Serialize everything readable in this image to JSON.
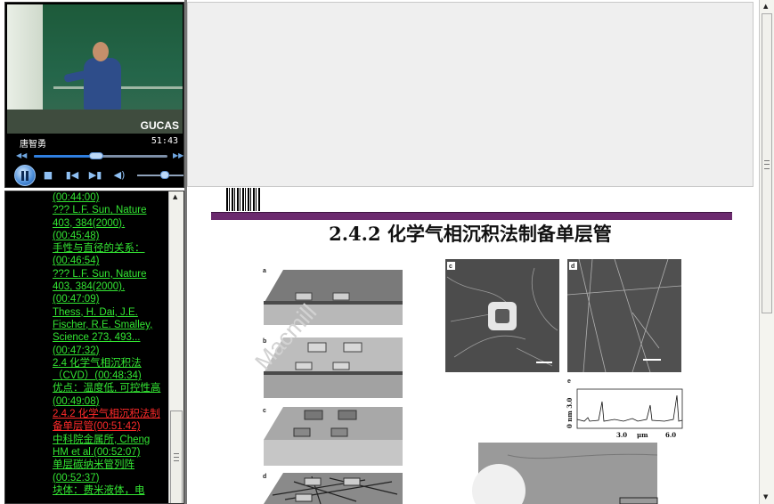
{
  "player": {
    "watermark": "GUCAS",
    "speaker": "唐智勇",
    "time": "51:43",
    "seek_progress": 0.52,
    "volume": 0.55,
    "controls": [
      "pause",
      "stop",
      "previous",
      "next",
      "volume"
    ]
  },
  "toc": {
    "items": [
      {
        "text": "(00:44:00)",
        "active": false
      },
      {
        "text": "??? L.F. Sun, Nature 403, 384(2000).(00:45:48)",
        "active": false
      },
      {
        "text": "手性与直径的关系：(00:46:54)",
        "active": false
      },
      {
        "text": "??? L.F. Sun, Nature 403, 384(2000).(00:47:09)",
        "active": false
      },
      {
        "text": "Thess, H. Dai, J.E. Fischer, R.E. Smalley, Science 273, 493...(00:47:32)",
        "active": false
      },
      {
        "text": "2.4 化学气相沉积法（CVD）(00:48:34)",
        "active": false
      },
      {
        "text": "优点：温度低, 可控性高(00:49:08)",
        "active": false
      },
      {
        "text": "2.4.2 化学气相沉积法制备单层管(00:51:42)",
        "active": true
      },
      {
        "text": "中科院金属所, Cheng HM et al.(00:52:07)",
        "active": false
      },
      {
        "text": "单层碳纳米管列阵(00:52:37)",
        "active": false
      },
      {
        "text": "块体：费米液体，电",
        "active": false
      }
    ]
  },
  "slide": {
    "title": "2.4.2 化学气相沉积法制备单层管",
    "watermark": "Macmill",
    "panels": {
      "a": "a",
      "b": "b",
      "c": "c",
      "d": "d",
      "e": "e",
      "f": "d"
    },
    "plot": {
      "ylabel": "0  nm  3.0",
      "x_tick_1": "3.0",
      "x_unit": "μm",
      "x_tick_2": "6.0"
    }
  },
  "colors": {
    "toc_link": "#33e633",
    "toc_active": "#ff2a2a",
    "slide_bar": "#6b2a6e"
  }
}
